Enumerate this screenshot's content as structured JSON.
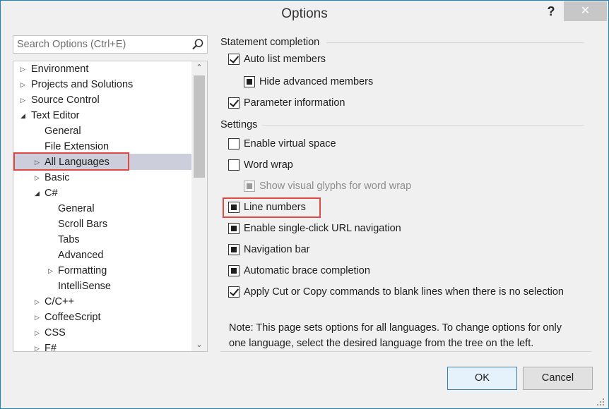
{
  "window": {
    "title": "Options",
    "help_glyph": "?",
    "close_glyph": "✕"
  },
  "search": {
    "placeholder": "Search Options (Ctrl+E)"
  },
  "tree": {
    "items": [
      {
        "label": "Environment",
        "arrow": "collapsed"
      },
      {
        "label": "Projects and Solutions",
        "arrow": "collapsed"
      },
      {
        "label": "Source Control",
        "arrow": "collapsed"
      },
      {
        "label": "Text Editor",
        "arrow": "expanded"
      },
      {
        "label": "General",
        "arrow": "none"
      },
      {
        "label": "File Extension",
        "arrow": "none"
      },
      {
        "label": "All Languages",
        "arrow": "collapsed",
        "selected": true
      },
      {
        "label": "Basic",
        "arrow": "collapsed"
      },
      {
        "label": "C#",
        "arrow": "expanded"
      },
      {
        "label": "General",
        "arrow": "none"
      },
      {
        "label": "Scroll Bars",
        "arrow": "none"
      },
      {
        "label": "Tabs",
        "arrow": "none"
      },
      {
        "label": "Advanced",
        "arrow": "none"
      },
      {
        "label": "Formatting",
        "arrow": "collapsed"
      },
      {
        "label": "IntelliSense",
        "arrow": "none"
      },
      {
        "label": "C/C++",
        "arrow": "collapsed"
      },
      {
        "label": "CoffeeScript",
        "arrow": "collapsed"
      },
      {
        "label": "CSS",
        "arrow": "collapsed"
      },
      {
        "label": "F#",
        "arrow": "collapsed"
      }
    ]
  },
  "statement_completion": {
    "heading": "Statement completion",
    "auto_list_members": {
      "label": "Auto list members",
      "state": "checked"
    },
    "hide_advanced_members": {
      "label": "Hide advanced members",
      "state": "indeterminate"
    },
    "parameter_information": {
      "label": "Parameter information",
      "state": "checked"
    }
  },
  "settings": {
    "heading": "Settings",
    "enable_virtual_space": {
      "label": "Enable virtual space",
      "state": "unchecked"
    },
    "word_wrap": {
      "label": "Word wrap",
      "state": "unchecked"
    },
    "show_visual_glyphs": {
      "label": "Show visual glyphs for word wrap",
      "state": "indeterminate-disabled"
    },
    "line_numbers": {
      "label": "Line numbers",
      "state": "indeterminate"
    },
    "single_click_url": {
      "label": "Enable single-click URL navigation",
      "state": "indeterminate"
    },
    "navigation_bar": {
      "label": "Navigation bar",
      "state": "indeterminate"
    },
    "brace_completion": {
      "label": "Automatic brace completion",
      "state": "indeterminate"
    },
    "cut_copy_blank": {
      "label": "Apply Cut or Copy commands to blank lines when there is no selection",
      "state": "checked"
    }
  },
  "note": {
    "line1": "Note: This page sets options for all languages. To change options for only",
    "line2": "one language, select the desired language from the tree on the left."
  },
  "buttons": {
    "ok": "OK",
    "cancel": "Cancel"
  },
  "colors": {
    "highlight_border": "#e04a46",
    "selection_bg": "#cccedb",
    "window_border": "#1e80c6"
  }
}
